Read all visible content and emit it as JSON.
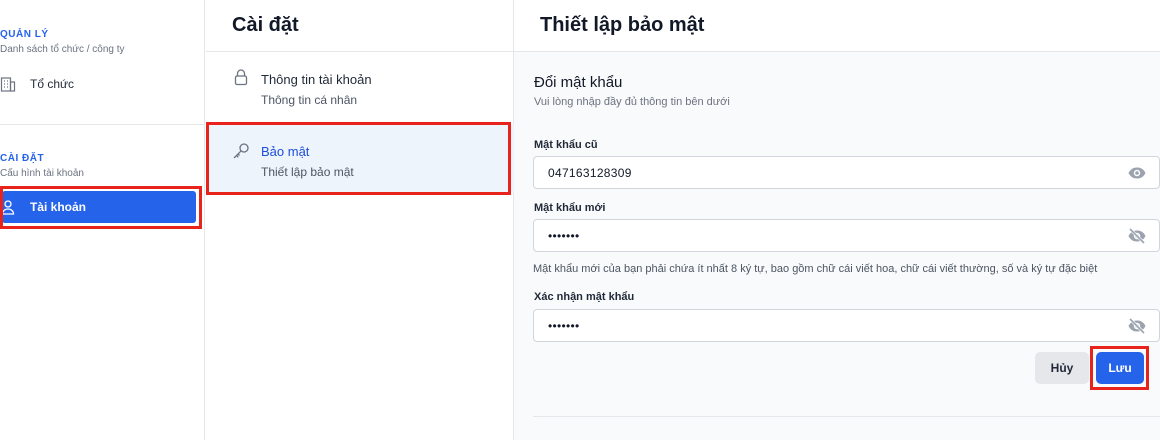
{
  "sidebar": {
    "section1_title": "QUẢN LÝ",
    "section1_sub": "Danh sách tổ chức / công ty",
    "item_org": {
      "label": "Tổ chức",
      "icon": "building-icon"
    },
    "section2_title": "CÀI ĐẶT",
    "section2_sub": "Cấu hình tài khoản",
    "item_account": {
      "label": "Tài khoản",
      "icon": "user-icon"
    }
  },
  "middle": {
    "title": "Cài đặt",
    "items": [
      {
        "label": "Thông tin tài khoản",
        "sub": "Thông tin cá nhân",
        "icon": "lock-icon"
      },
      {
        "label": "Bảo mật",
        "sub": "Thiết lập bảo mật",
        "icon": "key-icon"
      }
    ]
  },
  "right": {
    "title": "Thiết lập bảo mật",
    "form_title": "Đổi mật khẩu",
    "form_sub": "Vui lòng nhập đầy đủ thông tin bên dưới",
    "old_label": "Mật khẩu cũ",
    "old_value": "047163128309",
    "new_label": "Mật khẩu mới",
    "new_value": "•••••••",
    "hint": "Mật khẩu mới của bạn phải chứa ít nhất 8 ký tự, bao gồm chữ cái viết hoa, chữ cái viết thường, số và ký tự đặc biệt",
    "confirm_label": "Xác nhận mật khẩu",
    "confirm_value": "•••••••",
    "cancel_label": "Hủy",
    "save_label": "Lưu"
  },
  "colors": {
    "accent": "#2563eb",
    "highlight": "#e8231b",
    "active_menu_bg": "#eef4fb"
  }
}
